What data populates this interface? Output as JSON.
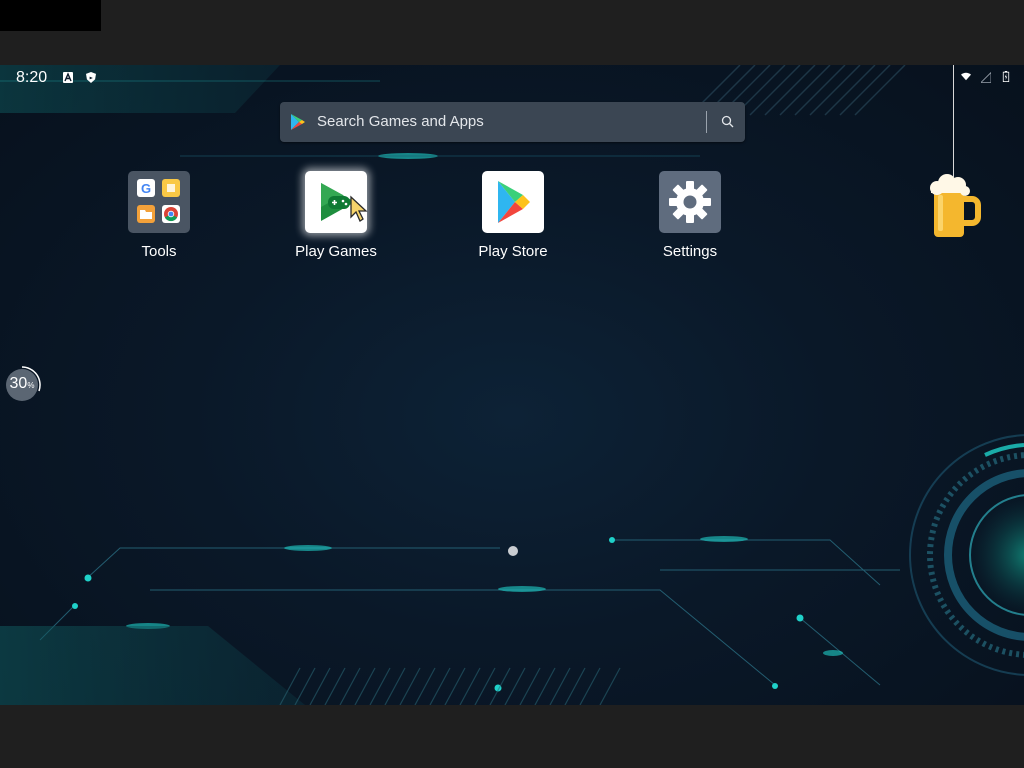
{
  "status_bar": {
    "time": "8:20"
  },
  "search": {
    "placeholder": "Search Games and Apps"
  },
  "apps": [
    {
      "label": "Tools"
    },
    {
      "label": "Play Games"
    },
    {
      "label": "Play Store"
    },
    {
      "label": "Settings"
    }
  ],
  "progress": {
    "value": "30",
    "unit": "%"
  },
  "colors": {
    "background": "#0a1828",
    "accent_teal": "#1fd1c9",
    "search_bg": "#3b4653",
    "settings_bg": "#5f6c7e"
  },
  "icons": [
    "android-a-icon",
    "shield-icon",
    "wifi-icon",
    "signal-icon",
    "battery-icon",
    "google-play-logo",
    "search-icon",
    "beer-mug-icon",
    "mouse-cursor-icon"
  ]
}
